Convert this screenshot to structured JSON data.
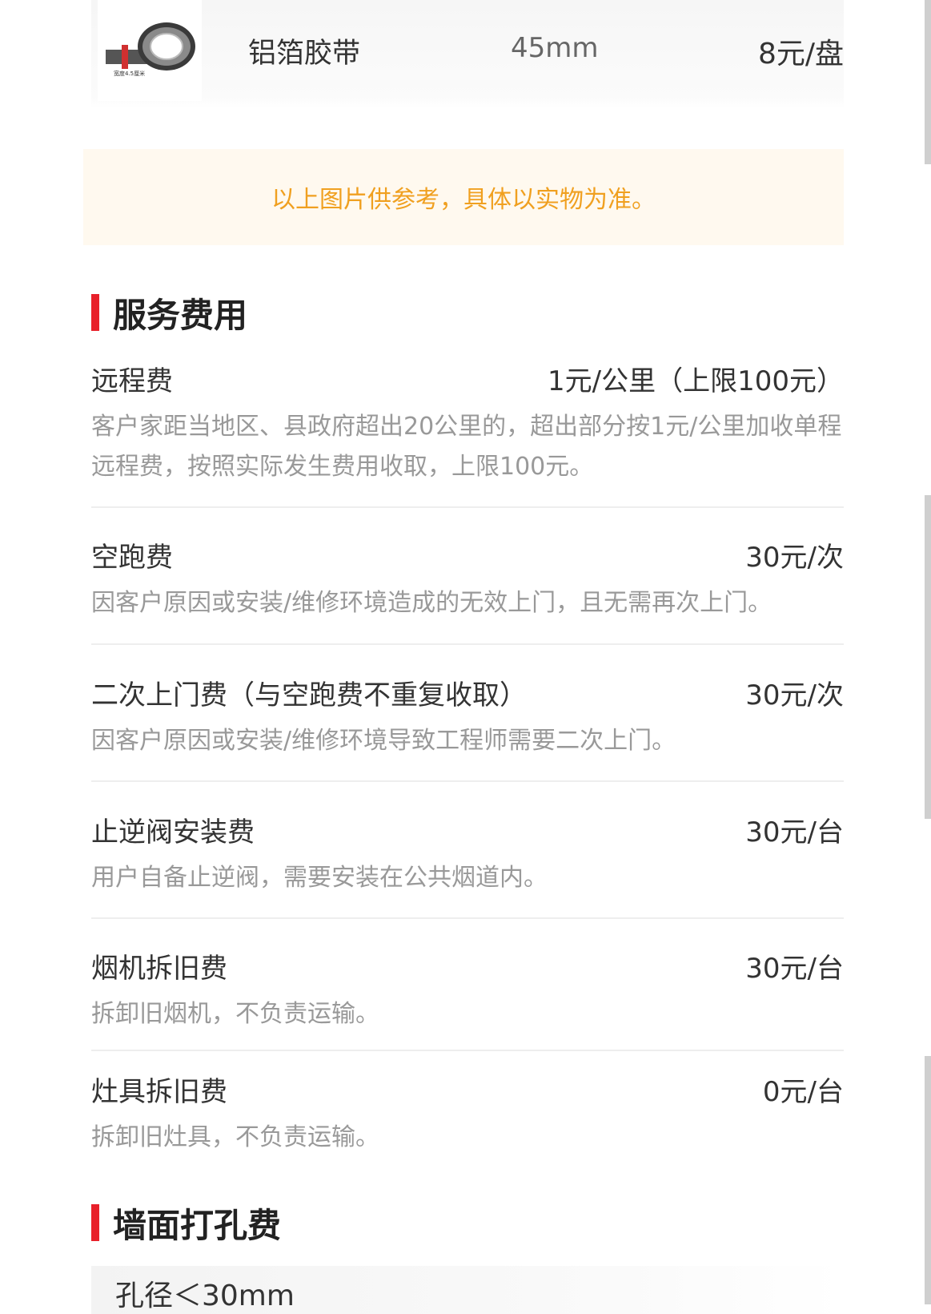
{
  "product": {
    "name": "铝箔胶带",
    "spec": "45mm",
    "price": "8元/盘",
    "image_icon": "aluminum-foil-tape-roll",
    "image_caption": "宽度4.5厘米"
  },
  "notice": "以上图片供参考，具体以实物为准。",
  "service_section": {
    "title": "服务费用",
    "items": [
      {
        "name": "远程费",
        "price": "1元/公里（上限100元）",
        "desc": "客户家距当地区、县政府超出20公里的，超出部分按1元/公里加收单程远程费，按照实际发生费用收取，上限100元。"
      },
      {
        "name": "空跑费",
        "price": "30元/次",
        "desc": "因客户原因或安装/维修环境造成的无效上门，且无需再次上门。"
      },
      {
        "name": "二次上门费（与空跑费不重复收取）",
        "price": "30元/次",
        "desc": "因客户原因或安装/维修环境导致工程师需要二次上门。"
      },
      {
        "name": "止逆阀安装费",
        "price": "30元/台",
        "desc": "用户自备止逆阀，需要安装在公共烟道内。"
      },
      {
        "name": "烟机拆旧费",
        "price": "30元/台",
        "desc": "拆卸旧烟机，不负责运输。"
      },
      {
        "name": "灶具拆旧费",
        "price": "0元/台",
        "desc": "拆卸旧灶具，不负责运输。"
      }
    ]
  },
  "wall_section": {
    "title": "墙面打孔费",
    "first_item": "孔径＜30mm"
  },
  "colors": {
    "accent_bar": "#e8202a",
    "notice_text": "#f0a020",
    "notice_bg": "#fff9ef",
    "desc_text": "#999999"
  }
}
